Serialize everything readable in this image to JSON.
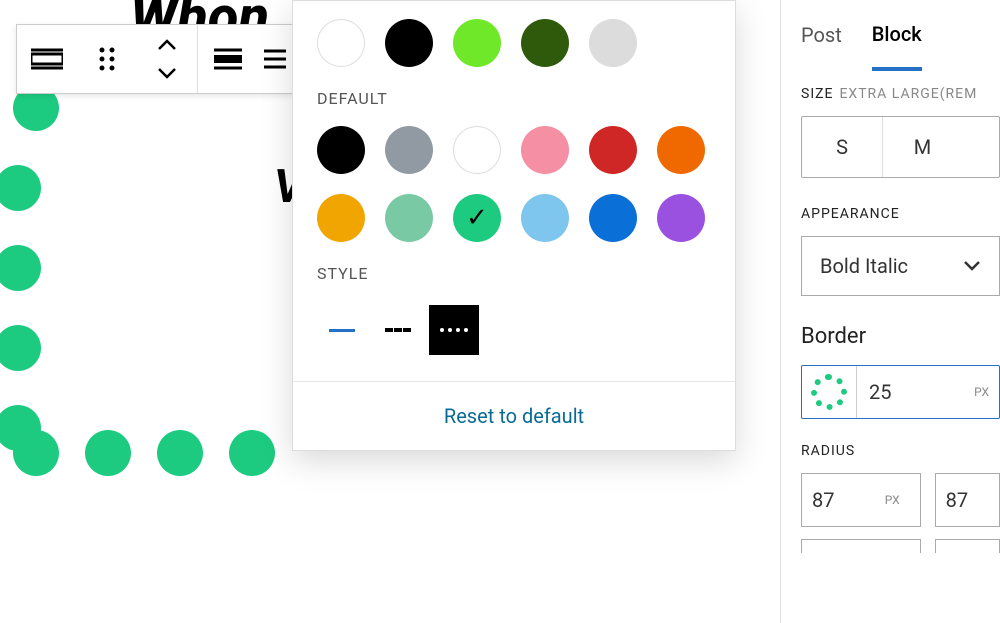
{
  "titleFragment": "Whon",
  "canvasWChar": "V",
  "tabs": {
    "post": "Post",
    "block": "Block"
  },
  "size": {
    "label": "SIZE",
    "current": "EXTRA LARGE(REM",
    "buttons": [
      "S",
      "M"
    ]
  },
  "appearance": {
    "label": "APPEARANCE",
    "select": "Bold Italic"
  },
  "border": {
    "heading": "Border",
    "value": "25",
    "unit": "PX"
  },
  "radius": {
    "label": "RADIUS",
    "values": [
      "87",
      "87"
    ],
    "unit": "PX"
  },
  "popover": {
    "topColors": [
      "#ffffff",
      "#000000",
      "#6fe82a",
      "#2f5a0b",
      "#dcdcdc"
    ],
    "defaultLabel": "DEFAULT",
    "defaultColors": [
      "#000000",
      "#919aa2",
      "#ffffff",
      "#f58fa4",
      "#cf2626",
      "#f06800",
      "#f0a500",
      "#79c9a4",
      "#1dcb80",
      "#7ec6ee",
      "#0a6fd6",
      "#9b51e0"
    ],
    "selectedIndex": 8,
    "styleLabel": "STYLE",
    "reset": "Reset to default"
  }
}
